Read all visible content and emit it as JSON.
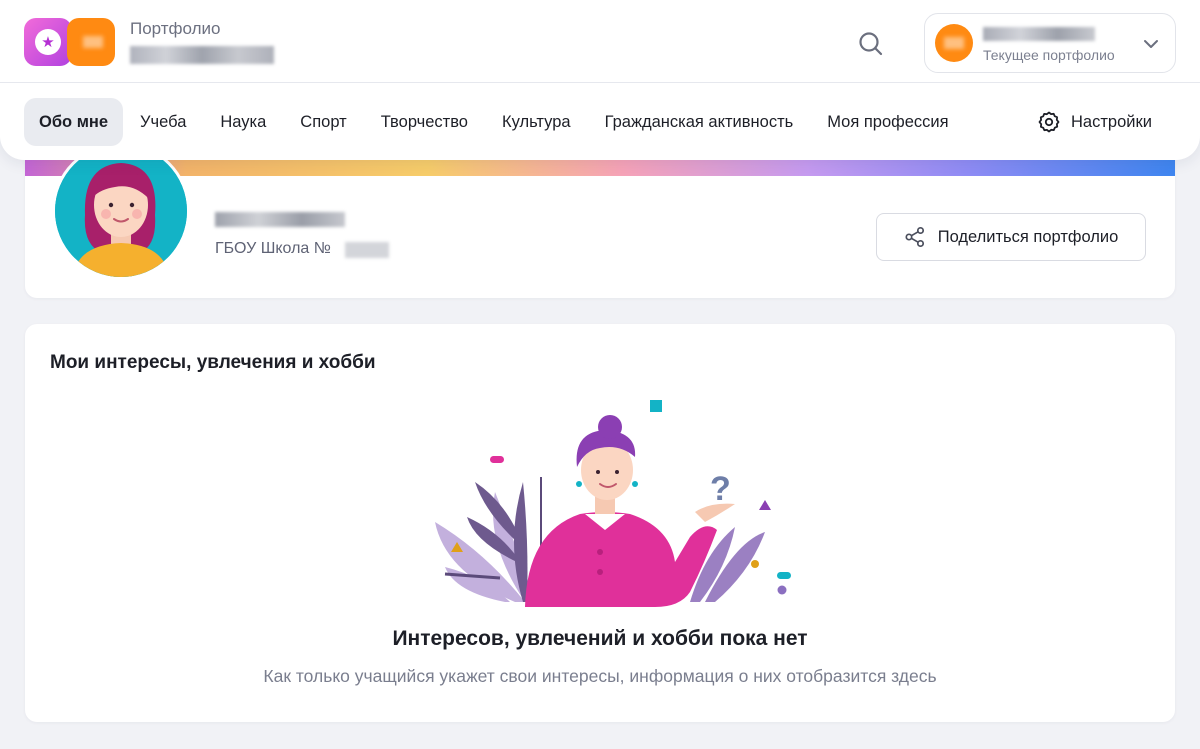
{
  "header": {
    "brand_title": "Портфолио",
    "current_profile_label": "Текущее портфолио",
    "accent_color": "#ff8a12",
    "logo_color": "#c04be0"
  },
  "nav": {
    "items": [
      {
        "label": "Обо мне",
        "active": true
      },
      {
        "label": "Учеба"
      },
      {
        "label": "Наука"
      },
      {
        "label": "Спорт"
      },
      {
        "label": "Творчество"
      },
      {
        "label": "Культура"
      },
      {
        "label": "Гражданская активность"
      },
      {
        "label": "Моя профессия"
      }
    ],
    "settings_label": "Настройки"
  },
  "profile": {
    "school_prefix": "ГБОУ Школа №",
    "share_label": "Поделиться портфолио"
  },
  "interests": {
    "title": "Мои интересы, увлечения и хобби",
    "empty_title": "Интересов, увлечений и хобби пока нет",
    "empty_description": "Как только учащийся укажет свои интересы, информация о них отобразится здесь"
  },
  "icons": [
    "star-logo-icon",
    "search-icon",
    "chevron-down-icon",
    "gear-icon",
    "share-icon"
  ]
}
